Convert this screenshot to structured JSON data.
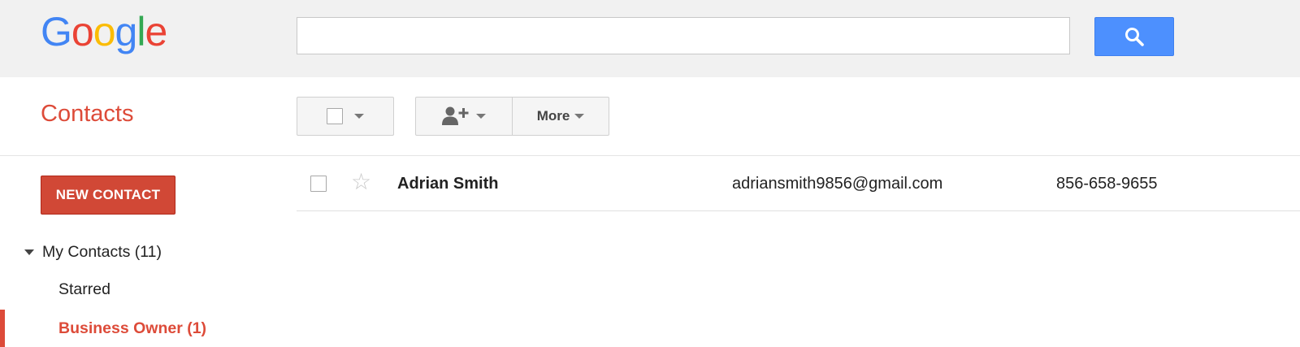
{
  "header": {
    "logo": [
      "G",
      "o",
      "o",
      "g",
      "l",
      "e"
    ],
    "logo_colors": [
      "#4285f4",
      "#ea4335",
      "#fbbc05",
      "#4285f4",
      "#34a853",
      "#ea4335"
    ],
    "search": {
      "value": "",
      "placeholder": ""
    }
  },
  "page": {
    "title": "Contacts"
  },
  "toolbar": {
    "more_label": "More"
  },
  "sidebar": {
    "new_contact_label": "NEW CONTACT",
    "group_label": "My Contacts (11)",
    "items": [
      {
        "label": "Starred"
      },
      {
        "label": "Business Owner (1)"
      }
    ]
  },
  "contacts": [
    {
      "name": "Adrian Smith",
      "email": "adriansmith9856@gmail.com",
      "phone": "856-658-9655",
      "starred": false
    }
  ],
  "colors": {
    "accent": "#dd4b39",
    "search_button": "#4d90fe"
  },
  "icons": {
    "search": "search-icon",
    "add_person": "person-add-icon",
    "star": "star-outline-icon"
  }
}
